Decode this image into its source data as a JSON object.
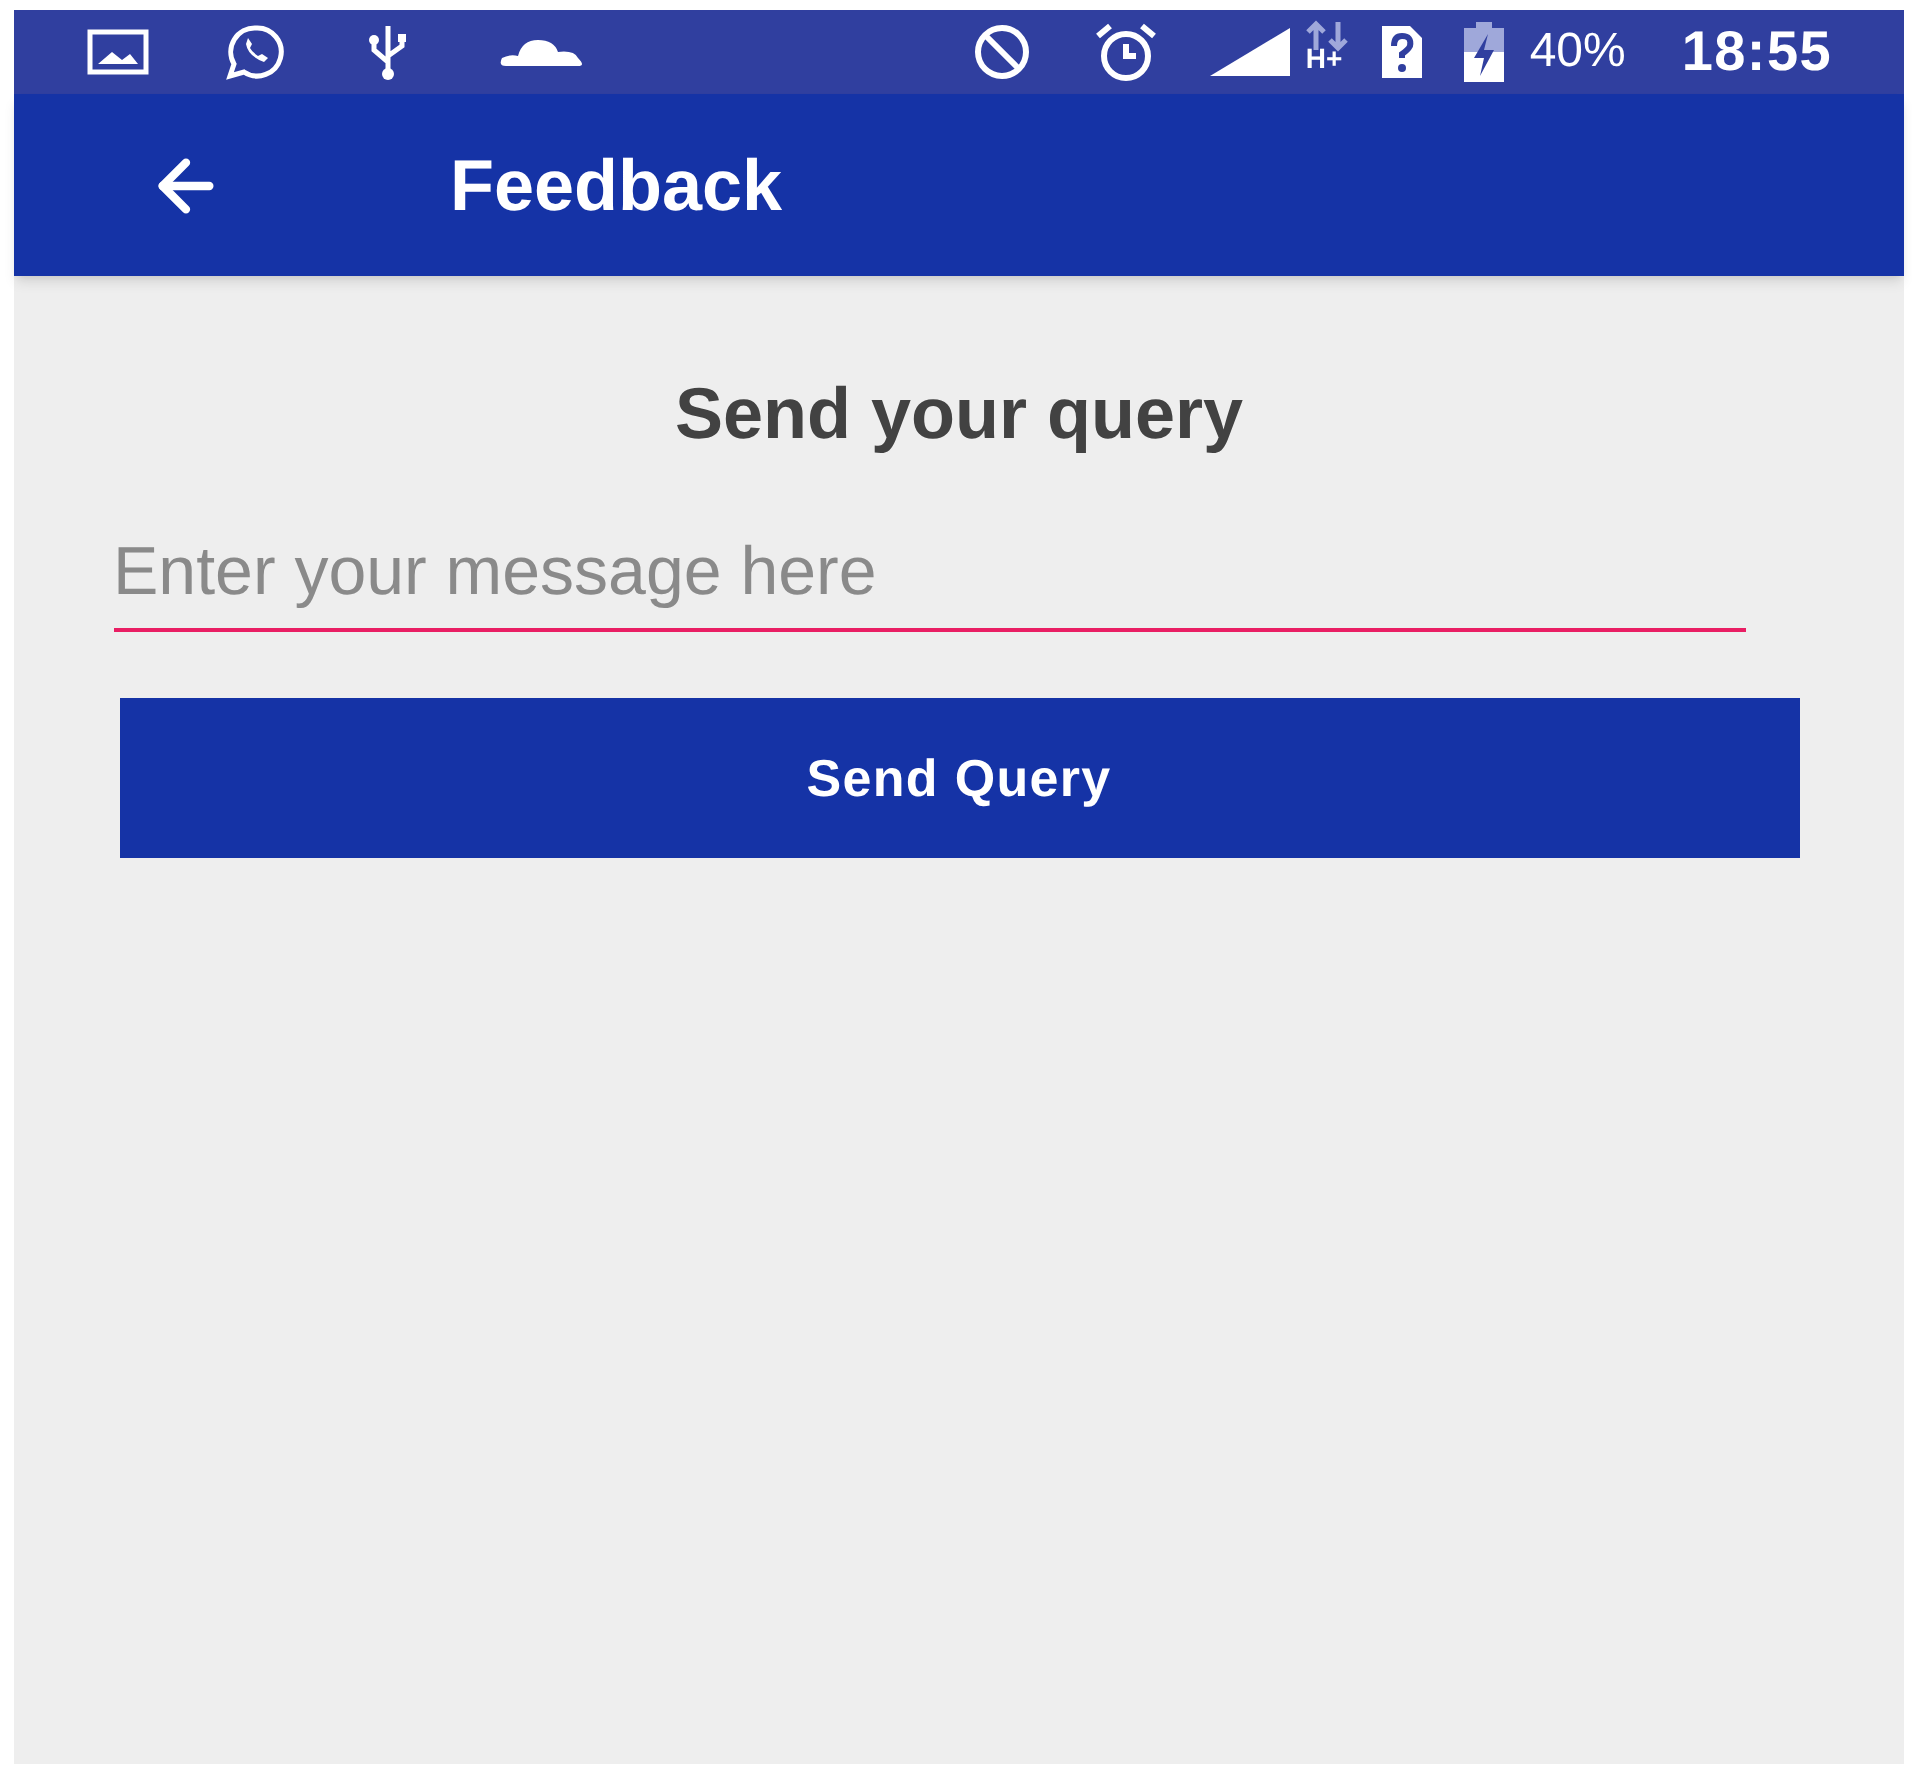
{
  "status_bar": {
    "network_type": "H+",
    "battery": "40%",
    "time": "18:55"
  },
  "app_bar": {
    "title": "Feedback"
  },
  "form": {
    "heading": "Send your query",
    "message": {
      "placeholder": "Enter your message here"
    },
    "submit": "Send Query"
  }
}
